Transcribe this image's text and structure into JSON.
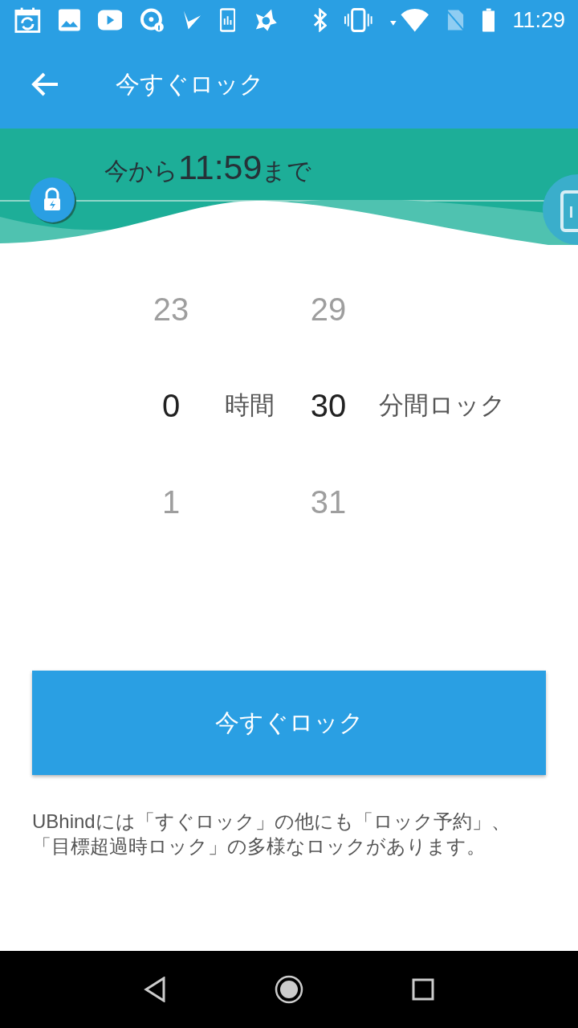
{
  "status_bar": {
    "time": "11:29"
  },
  "app_bar": {
    "title": "今すぐロック"
  },
  "banner": {
    "prefix": "今から",
    "time": "11:59",
    "suffix": "まで"
  },
  "picker": {
    "columns": [
      {
        "unit": "時間",
        "items": [
          {
            "label": "23",
            "selected": false
          },
          {
            "label": "0",
            "selected": true
          },
          {
            "label": "1",
            "selected": false
          }
        ]
      },
      {
        "unit": "分間ロック",
        "items": [
          {
            "label": "29",
            "selected": false
          },
          {
            "label": "30",
            "selected": true
          },
          {
            "label": "31",
            "selected": false
          }
        ]
      }
    ]
  },
  "lock_button": {
    "label": "今すぐロック"
  },
  "note": "UBhindには「すぐロック」の他にも「ロック予約」、「目標超過時ロック」の多様なロックがあります。"
}
